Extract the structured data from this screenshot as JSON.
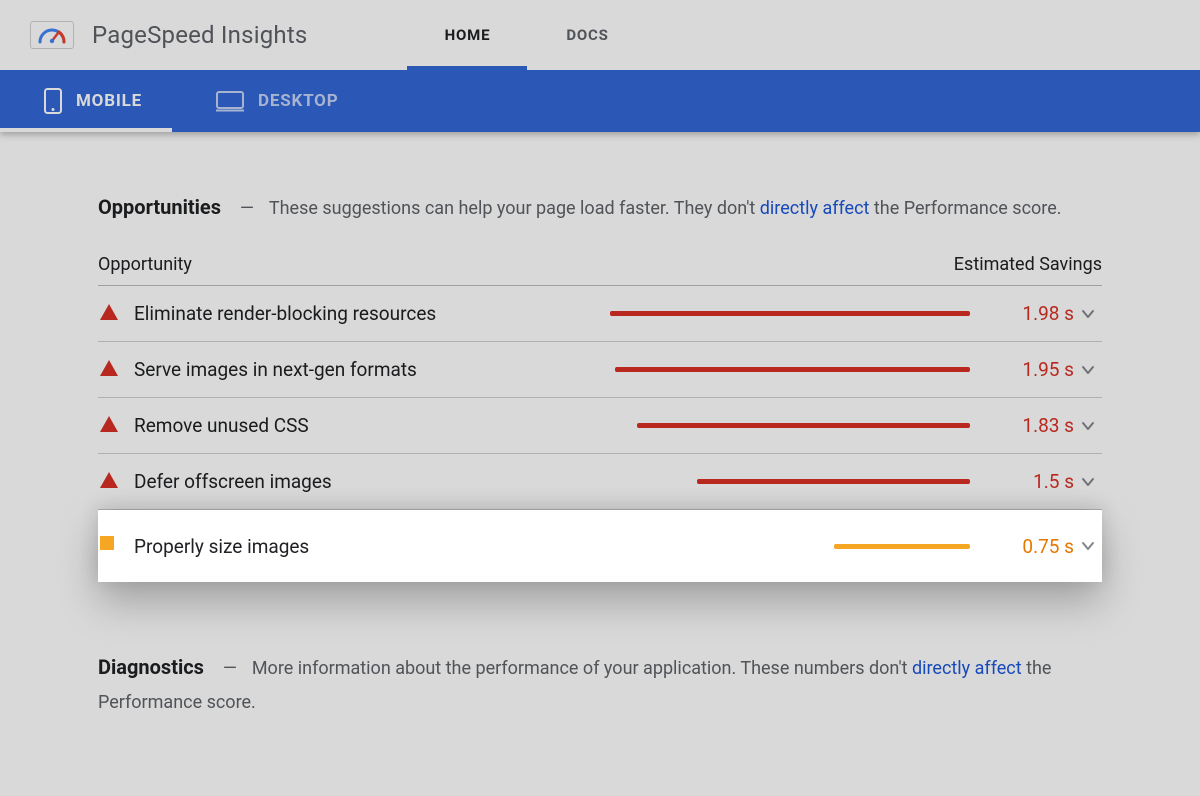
{
  "header": {
    "title": "PageSpeed Insights",
    "tabs": [
      {
        "label": "HOME",
        "active": true
      },
      {
        "label": "DOCS",
        "active": false
      }
    ]
  },
  "subtabs": [
    {
      "label": "MOBILE",
      "active": true,
      "icon": "mobile-icon"
    },
    {
      "label": "DESKTOP",
      "active": false,
      "icon": "desktop-icon"
    }
  ],
  "opportunities": {
    "title": "Opportunities",
    "desc_pre": "These suggestions can help your page load faster. They don't ",
    "desc_link": "directly affect",
    "desc_post": " the Performance score.",
    "col_opportunity": "Opportunity",
    "col_savings": "Estimated Savings",
    "max_savings_s": 1.98,
    "rows": [
      {
        "severity": "red-triangle",
        "label": "Eliminate render-blocking resources",
        "savings": "1.98 s",
        "savings_s": 1.98,
        "color": "red",
        "highlight": false
      },
      {
        "severity": "red-triangle",
        "label": "Serve images in next-gen formats",
        "savings": "1.95 s",
        "savings_s": 1.95,
        "color": "red",
        "highlight": false
      },
      {
        "severity": "red-triangle",
        "label": "Remove unused CSS",
        "savings": "1.83 s",
        "savings_s": 1.83,
        "color": "red",
        "highlight": false
      },
      {
        "severity": "red-triangle",
        "label": "Defer offscreen images",
        "savings": "1.5 s",
        "savings_s": 1.5,
        "color": "red",
        "highlight": false
      },
      {
        "severity": "orange-square",
        "label": "Properly size images",
        "savings": "0.75 s",
        "savings_s": 0.75,
        "color": "orange",
        "highlight": true
      }
    ]
  },
  "diagnostics": {
    "title": "Diagnostics",
    "desc_pre": "More information about the performance of your application. These numbers don't ",
    "desc_link": "directly affect",
    "desc_post": " the Performance score."
  }
}
